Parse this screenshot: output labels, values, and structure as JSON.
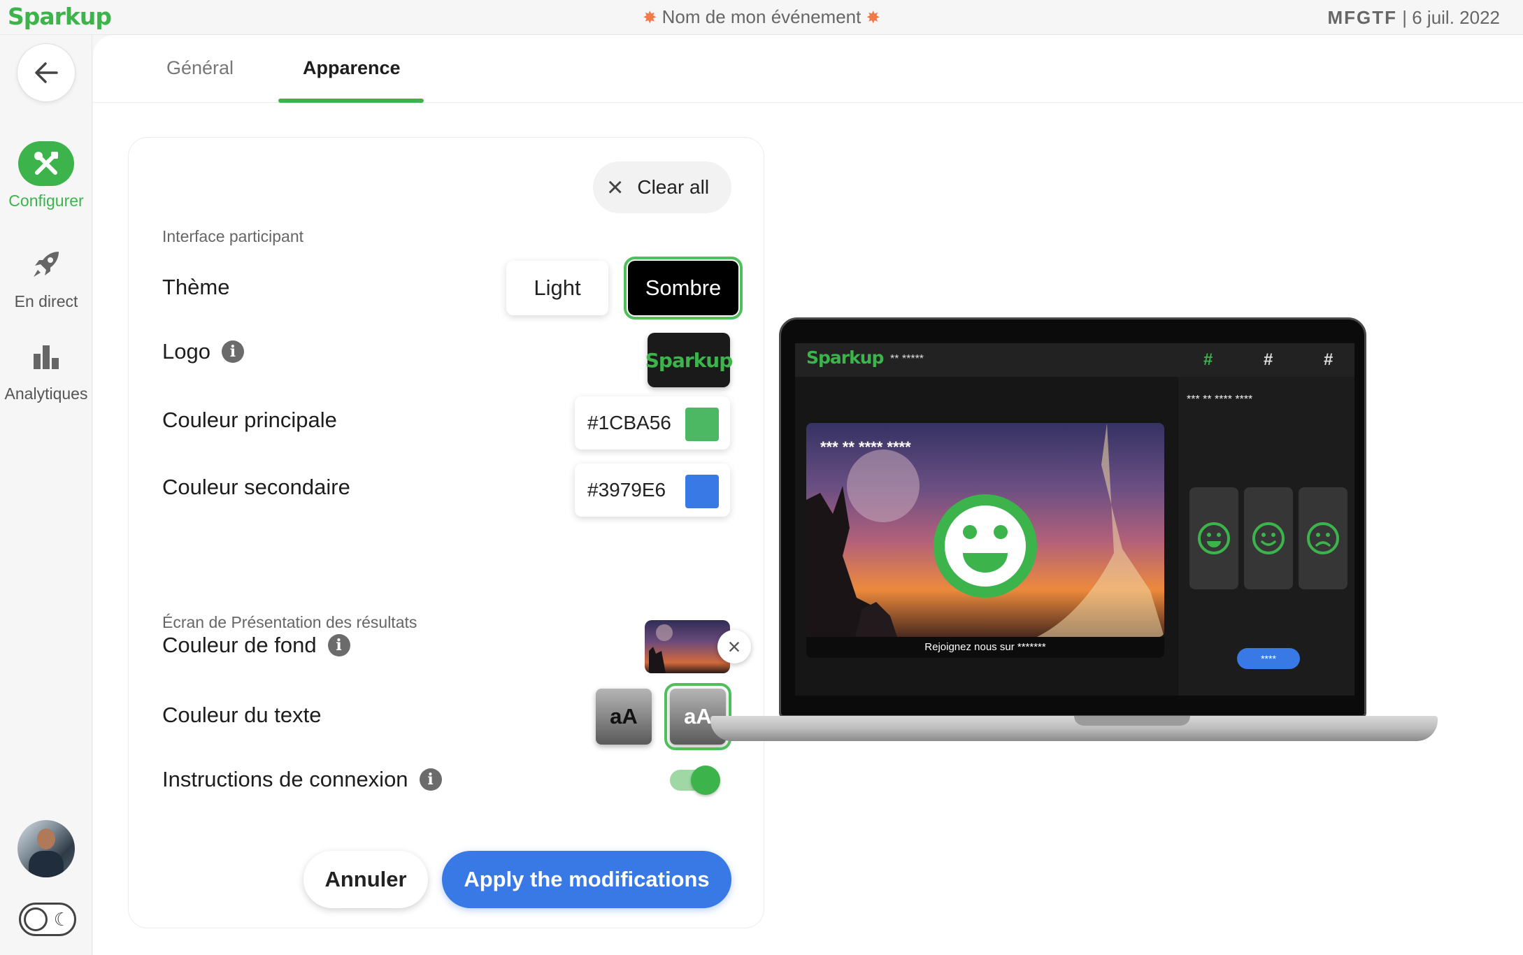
{
  "app": {
    "logo": "Sparkup"
  },
  "header": {
    "event_title": "Nom de mon événement",
    "event_code": "MFGTF",
    "separator": "|",
    "date": "6 juil. 2022"
  },
  "sidebar": {
    "items": [
      {
        "label": "Configurer",
        "icon": "tools-icon",
        "active": true
      },
      {
        "label": "En direct",
        "icon": "rocket-icon"
      },
      {
        "label": "Analytiques",
        "icon": "bar-chart-icon"
      }
    ]
  },
  "tabs": [
    {
      "label": "Général"
    },
    {
      "label": "Apparence",
      "active": true
    }
  ],
  "form": {
    "clear_all": "Clear all",
    "section_participant": "Interface participant",
    "theme_label": "Thème",
    "theme_light": "Light",
    "theme_dark": "Sombre",
    "logo_label": "Logo",
    "primary_color_label": "Couleur principale",
    "primary_color_value": "#1CBA56",
    "primary_color_swatch": "#4cb864",
    "secondary_color_label": "Couleur secondaire",
    "secondary_color_value": "#3979E6",
    "secondary_color_swatch": "#3979e6",
    "section_results": "Écran de Présentation des résultats",
    "background_label": "Couleur de fond",
    "text_color_label": "Couleur du texte",
    "text_color_dark": "aA",
    "text_color_light": "aA",
    "connection_label": "Instructions de connexion",
    "connection_enabled": true,
    "cancel": "Annuler",
    "apply": "Apply the modifications"
  },
  "preview": {
    "logo": "Sparkup",
    "subtitle": "** *****",
    "hash1": "#",
    "hash2": "#",
    "hash3": "#",
    "question": "*** ** **** ****",
    "title": "*** ** **** ****",
    "footer": "Rejoignez nous sur *******",
    "cta": "****"
  },
  "colors": {
    "accent": "#3cb44b",
    "apply": "#3979e6"
  }
}
